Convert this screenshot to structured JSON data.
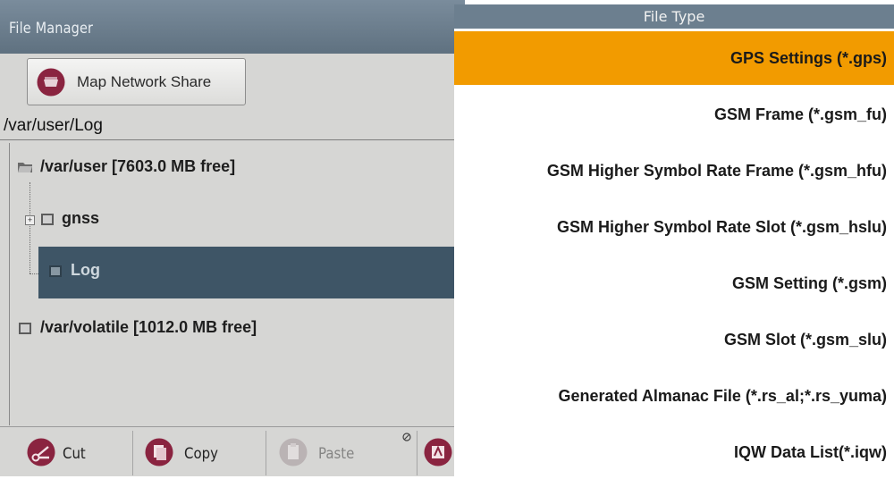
{
  "file_manager": {
    "title": "File Manager",
    "map_network_share_label": "Map Network Share",
    "current_path": "/var/user/Log",
    "tree": {
      "user_root": "/var/user  [7603.0 MB free]",
      "gnss": "gnss",
      "log": "Log",
      "volatile": "/var/volatile  [1012.0 MB free]"
    },
    "toolbar": {
      "cut": "Cut",
      "copy": "Copy",
      "paste": "Paste"
    }
  },
  "file_type": {
    "header": "File Type",
    "selected_index": 0,
    "items": [
      "GPS Settings (*.gps)",
      "GSM Frame (*.gsm_fu)",
      "GSM Higher Symbol Rate Frame (*.gsm_hfu)",
      "GSM Higher Symbol Rate Slot (*.gsm_hslu)",
      "GSM Setting (*.gsm)",
      "GSM Slot (*.gsm_slu)",
      "Generated Almanac File (*.rs_al;*.rs_yuma)",
      "IQW Data List(*.iqw)"
    ]
  },
  "colors": {
    "selection_orange": "#f29b00",
    "tree_selection": "#3e5566",
    "header_blue_gray": "#6c7f8f",
    "icon_crimson": "#8a2440"
  },
  "icons": {
    "map_network_share": "network-drive-icon",
    "cut": "scissors-icon",
    "copy": "copy-icon",
    "paste": "paste-icon",
    "folder": "folder-icon"
  }
}
